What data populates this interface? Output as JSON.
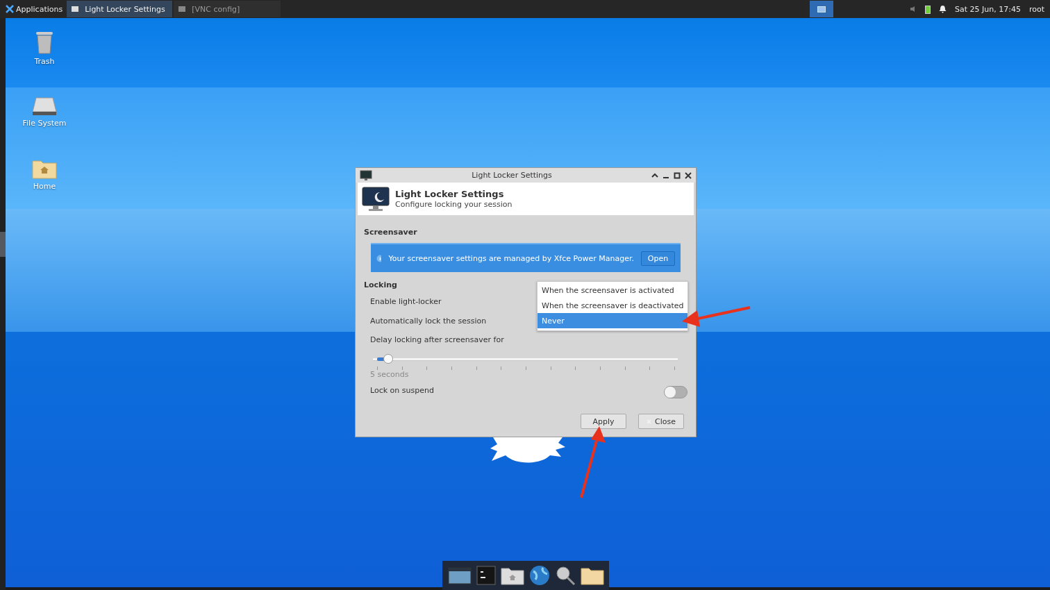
{
  "panel": {
    "menu": "Applications",
    "tasks": [
      {
        "label": "Light Locker Settings",
        "selected": true
      },
      {
        "label": "[VNC config]",
        "selected": false
      }
    ],
    "clock": "Sat 25 Jun, 17:45",
    "user": "root"
  },
  "desktop_icons": [
    {
      "label": "Trash",
      "kind": "trash"
    },
    {
      "label": "File System",
      "kind": "drive"
    },
    {
      "label": "Home",
      "kind": "home"
    }
  ],
  "dialog": {
    "title": "Light Locker Settings",
    "header_title": "Light Locker Settings",
    "header_subtitle": "Configure locking your session",
    "screensaver_heading": "Screensaver",
    "info_text": "Your screensaver settings are managed by Xfce Power Manager.",
    "info_button": "Open",
    "locking_heading": "Locking",
    "enable_label": "Enable light-locker",
    "auto_lock_label": "Automatically lock the session",
    "delay_label": "Delay locking after screensaver for",
    "delay_slider": {
      "level": 0.035,
      "reading": "5 seconds"
    },
    "lock_on_suspend": {
      "label": "Lock on suspend",
      "on": false
    },
    "buttons": [
      {
        "label": "Apply",
        "kind": "apply"
      },
      {
        "label": "Close",
        "kind": "close"
      }
    ]
  },
  "dropdown": {
    "options": [
      {
        "label": "When the screensaver is activated",
        "selected": false
      },
      {
        "label": "When the screensaver is deactivated",
        "selected": false
      },
      {
        "label": "Never",
        "selected": true
      }
    ]
  },
  "dock": [
    {
      "kind": "desktop"
    },
    {
      "kind": "terminal"
    },
    {
      "kind": "home-folder"
    },
    {
      "kind": "globe"
    },
    {
      "kind": "search"
    },
    {
      "kind": "folder"
    }
  ]
}
